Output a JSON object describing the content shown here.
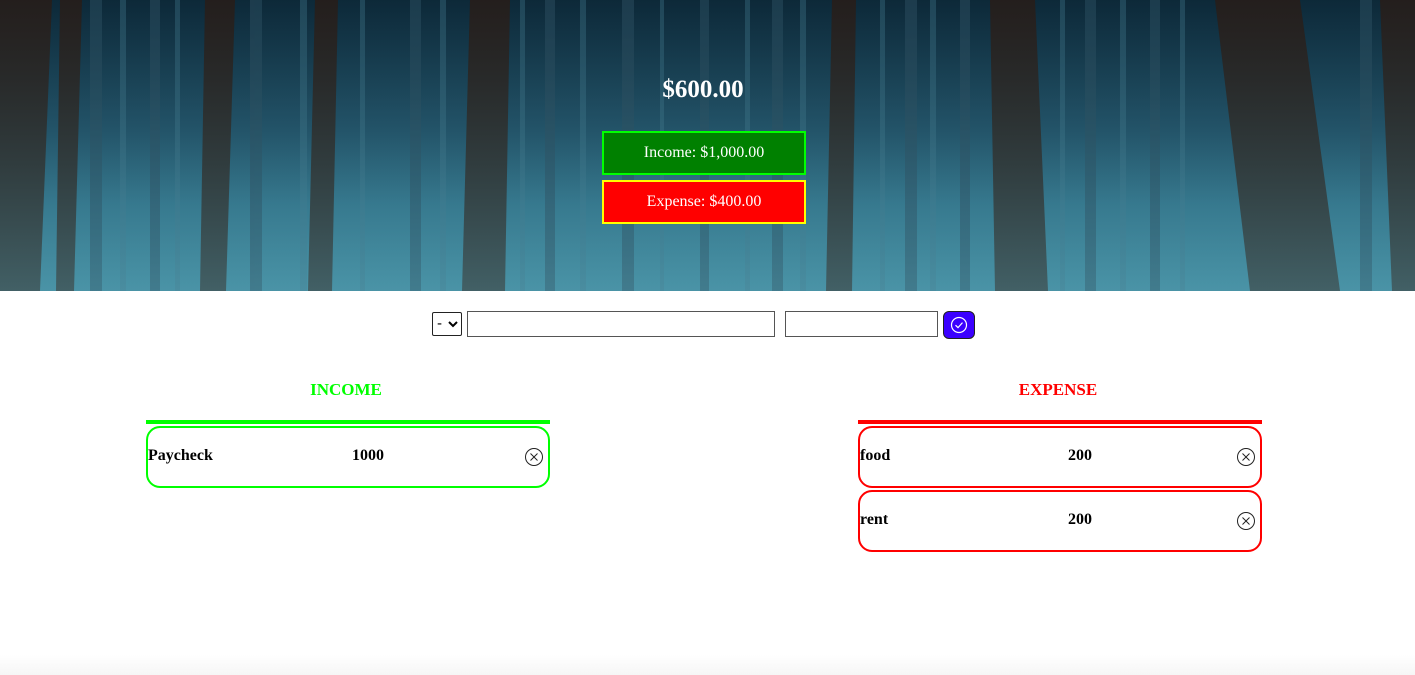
{
  "header": {
    "balance": "$600.00",
    "income_summary": "Income: $1,000.00",
    "expense_summary": "Expense: $400.00",
    "background": "forest-photo"
  },
  "form": {
    "type_selected": "-",
    "description_value": "",
    "value_value": "",
    "submit_icon": "checkmark-circle-icon"
  },
  "income": {
    "title": "INCOME",
    "color": "#00ff00",
    "items": [
      {
        "description": "Paycheck",
        "value": "1000"
      }
    ]
  },
  "expense": {
    "title": "EXPENSE",
    "color": "#ff0000",
    "items": [
      {
        "description": "food",
        "value": "200"
      },
      {
        "description": "rent",
        "value": "200"
      }
    ]
  },
  "colors": {
    "income_box": "#008000",
    "income_border": "#00ff00",
    "expense_box": "#ff0000",
    "expense_border": "#ffff00",
    "button": "#3b00ff"
  }
}
